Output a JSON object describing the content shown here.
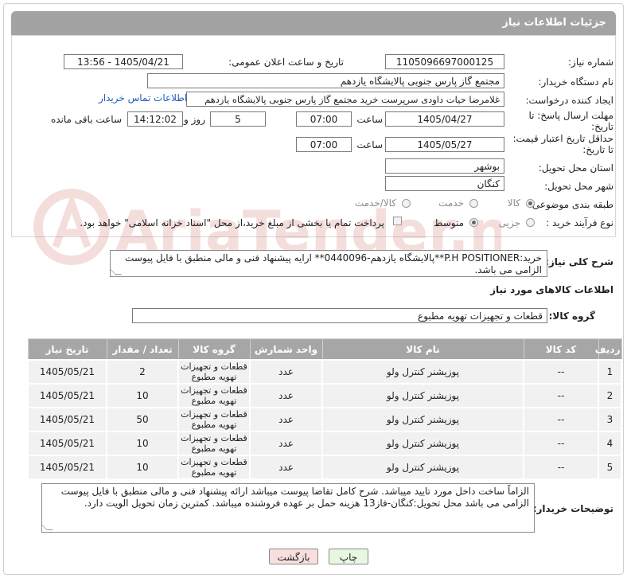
{
  "header": {
    "title": "جزئیات اطلاعات نیاز"
  },
  "fields": {
    "need_number_label": "شماره نیاز:",
    "need_number": "1105096697000125",
    "announce_label": "تاریخ و ساعت اعلان عمومی:",
    "announce_value": "1405/04/21 - 13:56",
    "buyer_org_label": "نام دستگاه خریدار:",
    "buyer_org": "مجتمع گاز پارس جنوبی  پالایشگاه یازدهم",
    "requester_label": "ایجاد کننده درخواست:",
    "requester": "غلامرضا حیات داودی سرپرست خرید مجتمع گاز پارس جنوبی  پالایشگاه یازدهم",
    "contact_link": "اطلاعات تماس خریدار",
    "deadline_label_1": "مهلت ارسال پاسخ: تا",
    "deadline_label_2": "تاریخ:",
    "deadline_date": "1405/04/27",
    "time_label": "ساعت",
    "deadline_time": "07:00",
    "days_value": "5",
    "days_label": "روز و",
    "remaining_time": "14:12:02",
    "remaining_label": "ساعت باقی مانده",
    "validity_label_1": "حداقل تاریخ اعتبار قیمت:",
    "validity_label_2": "تا تاریخ:",
    "validity_date": "1405/05/27",
    "validity_time": "07:00",
    "province_label": "استان محل تحویل:",
    "province": "بوشهر",
    "city_label": "شهر محل تحویل:",
    "city": "کنگان",
    "category_label": "طبقه بندی موضوعی:",
    "category_options": [
      "کالا",
      "خدمت",
      "کالا/خدمت"
    ],
    "process_label": "نوع فرآیند خرید :",
    "process_options": [
      "جزیی",
      "متوسط"
    ],
    "payment_note": "پرداخت تمام یا بخشی از مبلغ خرید،از محل \"اسناد خزانه اسلامی\" خواهد بود."
  },
  "description": {
    "label": "شرح کلی نیاز:",
    "text": "خرید:P.H POSITIONER**پالایشگاه یازدهم-0440096** ارایه پیشنهاد فنی و مالی منطبق با فایل پیوست الزامی می باشد."
  },
  "goods": {
    "section_title": "اطلاعات کالاهای مورد نیاز",
    "group_label": "گروه کالا:",
    "group_value": "قطعات و تجهیزات تهویه مطبوع",
    "columns": [
      "ردیف",
      "کد کالا",
      "نام کالا",
      "واحد شمارش",
      "گروه کالا",
      "تعداد / مقدار",
      "تاریخ نیاز"
    ],
    "rows": [
      {
        "idx": "1",
        "code": "--",
        "name": "پوزیشنر کنترل ولو",
        "unit": "عدد",
        "group": "قطعات و تجهیزات تهویه مطبوع",
        "qty": "2",
        "date": "1405/05/21"
      },
      {
        "idx": "2",
        "code": "--",
        "name": "پوزیشنر کنترل ولو",
        "unit": "عدد",
        "group": "قطعات و تجهیزات تهویه مطبوع",
        "qty": "10",
        "date": "1405/05/21"
      },
      {
        "idx": "3",
        "code": "--",
        "name": "پوزیشنر کنترل ولو",
        "unit": "عدد",
        "group": "قطعات و تجهیزات تهویه مطبوع",
        "qty": "50",
        "date": "1405/05/21"
      },
      {
        "idx": "4",
        "code": "--",
        "name": "پوزیشنر کنترل ولو",
        "unit": "عدد",
        "group": "قطعات و تجهیزات تهویه مطبوع",
        "qty": "10",
        "date": "1405/05/21"
      },
      {
        "idx": "5",
        "code": "--",
        "name": "پوزیشنر کنترل ولو",
        "unit": "عدد",
        "group": "قطعات و تجهیزات تهویه مطبوع",
        "qty": "10",
        "date": "1405/05/21"
      }
    ]
  },
  "buyer_notes": {
    "label": "توضیحات خریدار:",
    "text": "الزاماً ساخت داخل مورد تایید میباشد. شرح کامل تقاضا پیوست میباشد ارائه پیشنهاد فنی و مالی منطبق با فایل پیوست الزامی می باشد محل تحویل:کنگان-فاز13 هزینه حمل بر عهده فروشنده میباشد. کمترین زمان تحویل الویت دارد."
  },
  "buttons": {
    "print": "چاپ",
    "back": "بازگشت"
  },
  "watermark": {
    "text": "AriaTender.neT"
  },
  "colors": {
    "header_bg": "#a3a3a3",
    "link": "#1f5fbf",
    "print_btn": "#e8f7e2",
    "back_btn": "#f9dede"
  }
}
